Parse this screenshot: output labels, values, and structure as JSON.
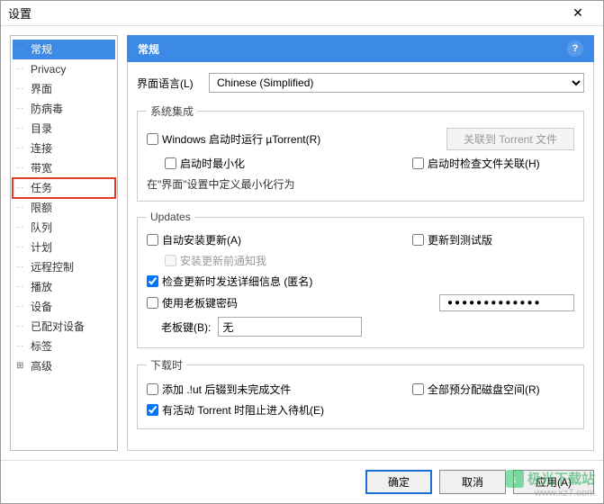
{
  "window": {
    "title": "设置"
  },
  "sidebar": {
    "items": [
      {
        "label": "常规",
        "selected": true
      },
      {
        "label": "Privacy"
      },
      {
        "label": "界面"
      },
      {
        "label": "防病毒"
      },
      {
        "label": "目录"
      },
      {
        "label": "连接"
      },
      {
        "label": "带宽"
      },
      {
        "label": "任务",
        "highlighted": true
      },
      {
        "label": "限额"
      },
      {
        "label": "队列"
      },
      {
        "label": "计划"
      },
      {
        "label": "远程控制"
      },
      {
        "label": "播放"
      },
      {
        "label": "设备"
      },
      {
        "label": "已配对设备"
      },
      {
        "label": "标签"
      },
      {
        "label": "高级",
        "expandable": true
      }
    ]
  },
  "header": {
    "title": "常规",
    "help": "?"
  },
  "lang": {
    "label": "界面语言(L)",
    "value": "Chinese (Simplified)"
  },
  "groups": {
    "system": {
      "legend": "系统集成",
      "startup": "Windows 启动时运行 µTorrent(R)",
      "assoc_btn": "关联到 Torrent 文件",
      "minimize": "启动时最小化",
      "check_assoc": "启动时检查文件关联(H)",
      "note": "在\"界面\"设置中定义最小化行为"
    },
    "updates": {
      "legend": "Updates",
      "auto": "自动安装更新(A)",
      "beta": "更新到测试版",
      "notify": "安装更新前通知我",
      "send_anon": "检查更新时发送详细信息 (匿名)",
      "boss_pwd": "使用老板键密码",
      "pwd_value": "●●●●●●●●●●●●●",
      "boss_label": "老板键(B):",
      "boss_value": "无"
    },
    "download": {
      "legend": "下载时",
      "append_ut": "添加 .!ut 后辍到未完成文件",
      "prealloc": "全部预分配磁盘空间(R)",
      "prevent_standby": "有活动 Torrent 时阻止进入待机(E)"
    }
  },
  "footer": {
    "ok": "确定",
    "cancel": "取消",
    "apply": "应用(A)"
  },
  "watermark": {
    "name": "极光下载站",
    "url": "www.xz7.com"
  }
}
